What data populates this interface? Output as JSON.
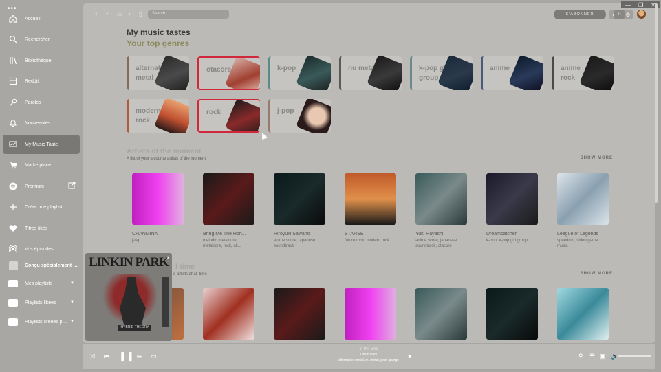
{
  "sidebar": {
    "items": [
      {
        "label": "Accueil",
        "icon": "home-icon"
      },
      {
        "label": "Rechercher",
        "icon": "search-icon"
      },
      {
        "label": "Bibliothèque",
        "icon": "library-icon"
      },
      {
        "label": "Reddit",
        "icon": "reddit-icon"
      },
      {
        "label": "Paroles",
        "icon": "microphone-icon"
      },
      {
        "label": "Nouveautés",
        "icon": "bell-icon"
      },
      {
        "label": "My Music Taste",
        "icon": "chart-icon"
      },
      {
        "label": "Marketplace",
        "icon": "cart-icon"
      },
      {
        "label": "Premium",
        "icon": "spotify-icon"
      },
      {
        "label": "Créer une playlist",
        "icon": "plus-icon"
      },
      {
        "label": "Titres likés",
        "icon": "heart-icon"
      },
      {
        "label": "Vos épisodes",
        "icon": "podcast-icon"
      },
      {
        "label": "Conçu spécialement p...",
        "icon": "playlist-thumb"
      },
      {
        "label": "Mes playlists",
        "icon": "folder-icon"
      },
      {
        "label": "Playlists likées",
        "icon": "folder-icon"
      },
      {
        "label": "Playlists créées pour ...",
        "icon": "folder-icon"
      }
    ]
  },
  "topbar": {
    "search_placeholder": "Search",
    "subscribe_label": "S'ABONNER"
  },
  "page": {
    "title": "My music tastes",
    "top_genres_title": "Your top genres"
  },
  "genres": [
    {
      "name": "alternative metal",
      "color": "#8a6a5a"
    },
    {
      "name": "otacore",
      "color": "#d0283a"
    },
    {
      "name": "k-pop",
      "color": "#5a8a8a"
    },
    {
      "name": "nu metal",
      "color": "#5a5a5a"
    },
    {
      "name": "k-pop girl group",
      "color": "#6a8a8a"
    },
    {
      "name": "anime",
      "color": "#4a5a7a"
    },
    {
      "name": "anime rock",
      "color": "#4a4a4a"
    },
    {
      "name": "modern rock",
      "color": "#b05a3a"
    },
    {
      "name": "rock",
      "color": "#d0283a"
    },
    {
      "name": "j-pop",
      "color": "#9a7a6a"
    }
  ],
  "artists_moment": {
    "title": "Artists of the moment",
    "description": "A list of your favourite artists of the moment",
    "show_more": "SHOW MORE",
    "items": [
      {
        "name": "CHANMINA",
        "genres": "j-rap"
      },
      {
        "name": "Bring Me The Hori...",
        "genres": "melodic metalcore, metalcore, rock, uk..."
      },
      {
        "name": "Hiroyuki Sawano",
        "genres": "anime score, japanese soundtrack"
      },
      {
        "name": "STARSET",
        "genres": "future rock, modern rock"
      },
      {
        "name": "Yuki Hayashi",
        "genres": "anime score, japanese soundtrack, otacore"
      },
      {
        "name": "Dreamcatcher",
        "genres": "k-pop, k-pop girl group"
      },
      {
        "name": "League of Legends",
        "genres": "speedrun, video game music"
      }
    ]
  },
  "artists_alltime": {
    "title_fragment": "l-time",
    "description_fragment": "e artists of all-time",
    "show_more": "SHOW MORE"
  },
  "player": {
    "track": "In the End",
    "artist": "Linkin Park",
    "genres": "alternative metal, nu metal, post-grunge"
  },
  "album_art": {
    "band": "LINKIN PARK",
    "tag": "HYBRID THEORY"
  }
}
